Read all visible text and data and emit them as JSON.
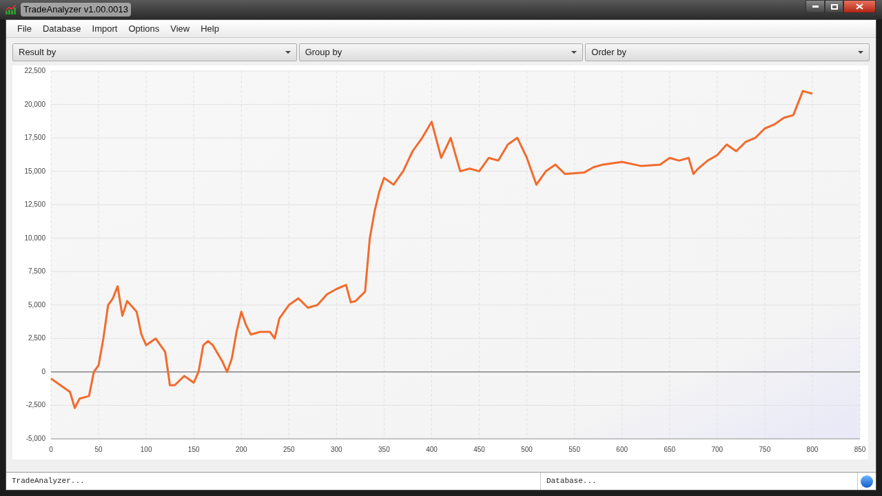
{
  "window": {
    "title": "TradeAnalyzer v1.00.0013"
  },
  "menu": [
    "File",
    "Database",
    "Import",
    "Options",
    "View",
    "Help"
  ],
  "dropdowns": [
    {
      "label": "Result by"
    },
    {
      "label": "Group by"
    },
    {
      "label": "Order by"
    }
  ],
  "chart_data": {
    "type": "line",
    "x": [
      0,
      10,
      20,
      25,
      30,
      40,
      45,
      50,
      55,
      60,
      65,
      70,
      75,
      80,
      90,
      95,
      100,
      110,
      120,
      125,
      130,
      140,
      150,
      155,
      160,
      165,
      170,
      180,
      185,
      190,
      195,
      200,
      205,
      210,
      220,
      230,
      235,
      240,
      250,
      260,
      270,
      280,
      290,
      300,
      310,
      315,
      320,
      330,
      335,
      340,
      345,
      350,
      360,
      370,
      380,
      390,
      400,
      410,
      420,
      430,
      440,
      450,
      460,
      470,
      480,
      490,
      500,
      510,
      520,
      530,
      540,
      560,
      570,
      580,
      600,
      620,
      640,
      650,
      660,
      670,
      675,
      680,
      690,
      700,
      710,
      720,
      730,
      740,
      750,
      760,
      770,
      780,
      790,
      800
    ],
    "grid": true,
    "series": [
      {
        "color": "#f26b2c",
        "values": [
          -500,
          -1000,
          -1500,
          -2700,
          -2000,
          -1800,
          0,
          500,
          2500,
          5000,
          5500,
          6400,
          4200,
          5300,
          4500,
          2800,
          2000,
          2500,
          1500,
          -1000,
          -1000,
          -300,
          -800,
          0,
          2000,
          2300,
          2000,
          800,
          0,
          1000,
          3000,
          4500,
          3500,
          2800,
          3000,
          3000,
          2500,
          4000,
          5000,
          5500,
          4800,
          5000,
          5800,
          6200,
          6500,
          5200,
          5300,
          6000,
          10000,
          12000,
          13500,
          14500,
          14000,
          15000,
          16500,
          17500,
          18700,
          16000,
          17500,
          15000,
          15200,
          15000,
          16000,
          15800,
          17000,
          17500,
          16000,
          14000,
          15000,
          15500,
          14800,
          14900,
          15300,
          15500,
          15700,
          15400,
          15500,
          16000,
          15800,
          16000,
          14800,
          15200,
          15800,
          16200,
          17000,
          16500,
          17200,
          17500,
          18200,
          18500,
          19000,
          19200,
          21000,
          20800
        ]
      }
    ],
    "xlim": [
      0,
      850
    ],
    "ylim": [
      -5000,
      22500
    ],
    "xticks": [
      0,
      50,
      100,
      150,
      200,
      250,
      300,
      350,
      400,
      450,
      500,
      550,
      600,
      650,
      700,
      750,
      800,
      850
    ],
    "yticks": [
      {
        "value": -5000,
        "label": "-5,000"
      },
      {
        "value": -2500,
        "label": "-2,500"
      },
      {
        "value": 0,
        "label": "0"
      },
      {
        "value": 2500,
        "label": "2,500"
      },
      {
        "value": 5000,
        "label": "5,000"
      },
      {
        "value": 7500,
        "label": "7,500"
      },
      {
        "value": 10000,
        "label": "10,000"
      },
      {
        "value": 12500,
        "label": "12,500"
      },
      {
        "value": 15000,
        "label": "15,000"
      },
      {
        "value": 17500,
        "label": "17,500"
      },
      {
        "value": 20000,
        "label": "20,000"
      },
      {
        "value": 22500,
        "label": "22,500"
      }
    ]
  },
  "status_bar": [
    "TradeAnalyzer...",
    "Database..."
  ]
}
